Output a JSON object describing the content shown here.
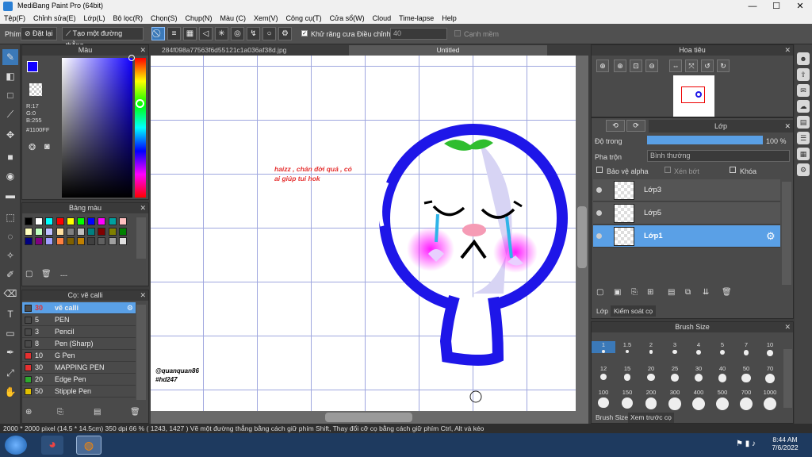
{
  "window": {
    "title": "MediBang Paint Pro (64bit)",
    "min": "—",
    "max": "☐",
    "close": "✕"
  },
  "menu": [
    "Tệp(F)",
    "Chỉnh sửa(E)",
    "Lớp(L)",
    "Bộ lọc(R)",
    "Chọn(S)",
    "Chụp(N)",
    "Màu (C)",
    "Xem(V)",
    "Công cụ(T)",
    "Cửa sổ(W)",
    "Cloud",
    "Time-lapse",
    "Help"
  ],
  "toolbar": {
    "brush_label": "Phím",
    "reset_label": "Đặt lại",
    "straight_label": "Tạo một đường thẳng",
    "antialias_label": "Khử răng cưa",
    "adjust_label": "Điều chỉnh",
    "adjust_value": "40",
    "smooth_label": "Cạnh mềm"
  },
  "tabs": [
    "284f098a77563f6d55121c1a036af38d.jpg",
    "Untitled"
  ],
  "color_panel": {
    "title": "Màu",
    "r": "R:17",
    "g": "G:0",
    "b": "B:255",
    "hex": "#1100FF",
    "fg": "#1100ff"
  },
  "palette_panel": {
    "title": "Bảng màu",
    "footer": "---",
    "colors": [
      "#000000",
      "#ffffff",
      "#00ffff",
      "#ff0000",
      "#ffff00",
      "#00ff00",
      "#0000ff",
      "#ff00ff",
      "#00a0a0",
      "#ffc0c0",
      "#ffffc0",
      "#c0ffc0",
      "#c0c0ff",
      "#ffe0a0",
      "#808080",
      "#c0c0c0",
      "#008080",
      "#800000",
      "#808000",
      "#008000",
      "#000080",
      "#800080",
      "#a0a0ff",
      "#ff8040",
      "#806000",
      "#c08000",
      "#404040",
      "#606060",
      "#a0a0a0",
      "#e0e0e0"
    ]
  },
  "brush_panel": {
    "title": "Cọ: vẽ calli",
    "items": [
      {
        "num": "30",
        "name": "vẽ calli",
        "color": "#4a4a4a"
      },
      {
        "num": "5",
        "name": "PEN",
        "color": "#4a4a4a"
      },
      {
        "num": "3",
        "name": "Pencil",
        "color": "#4a4a4a"
      },
      {
        "num": "8",
        "name": "Pen (Sharp)",
        "color": "#4a4a4a"
      },
      {
        "num": "10",
        "name": "G Pen",
        "color": "#e53030"
      },
      {
        "num": "30",
        "name": "MAPPING PEN",
        "color": "#e53030"
      },
      {
        "num": "20",
        "name": "Edge Pen",
        "color": "#2ea82e"
      },
      {
        "num": "50",
        "name": "Stipple Pen",
        "color": "#e0c000"
      }
    ]
  },
  "navigator": {
    "title": "Hoa tiêu"
  },
  "layer_panel": {
    "title": "Lớp",
    "opacity_label": "Độ trong",
    "opacity_value": "100 %",
    "opacity": 1.0,
    "blend_label": "Pha trộn",
    "blend_value": "Bình thường",
    "protect_alpha": "Bảo vệ alpha",
    "clipping": "Xén bớt",
    "lock": "Khóa",
    "layers": [
      "Lớp3",
      "Lớp5",
      "Lớp1"
    ],
    "tab_layer": "Lớp",
    "tab_brush_ctrl": "Kiểm soát cọ"
  },
  "brush_size_panel": {
    "title": "Brush Size",
    "sizes": [
      "1",
      "1.5",
      "2",
      "3",
      "4",
      "5",
      "7",
      "10",
      "12",
      "15",
      "20",
      "25",
      "30",
      "40",
      "50",
      "70",
      "100",
      "150",
      "200",
      "300",
      "400",
      "500",
      "700",
      "1000"
    ],
    "tab_size": "Brush Size",
    "tab_preview": "Xem trước cọ"
  },
  "canvas": {
    "note": "haizz , chán đời quá , có ai giúp tui hok",
    "sign1": "@quanquan86",
    "sign2": "#hd247"
  },
  "status": "2000 * 2000 pixel   (14.5 * 14.5cm)   350 dpi   66 %   ( 1243, 1427 )   Vẽ một đường thẳng bằng cách giữ phím Shift, Thay đổi cỡ cọ bằng cách giữ phím Ctrl, Alt và kéo",
  "taskbar": {
    "time": "8:44 AM",
    "date": "7/6/2022"
  }
}
